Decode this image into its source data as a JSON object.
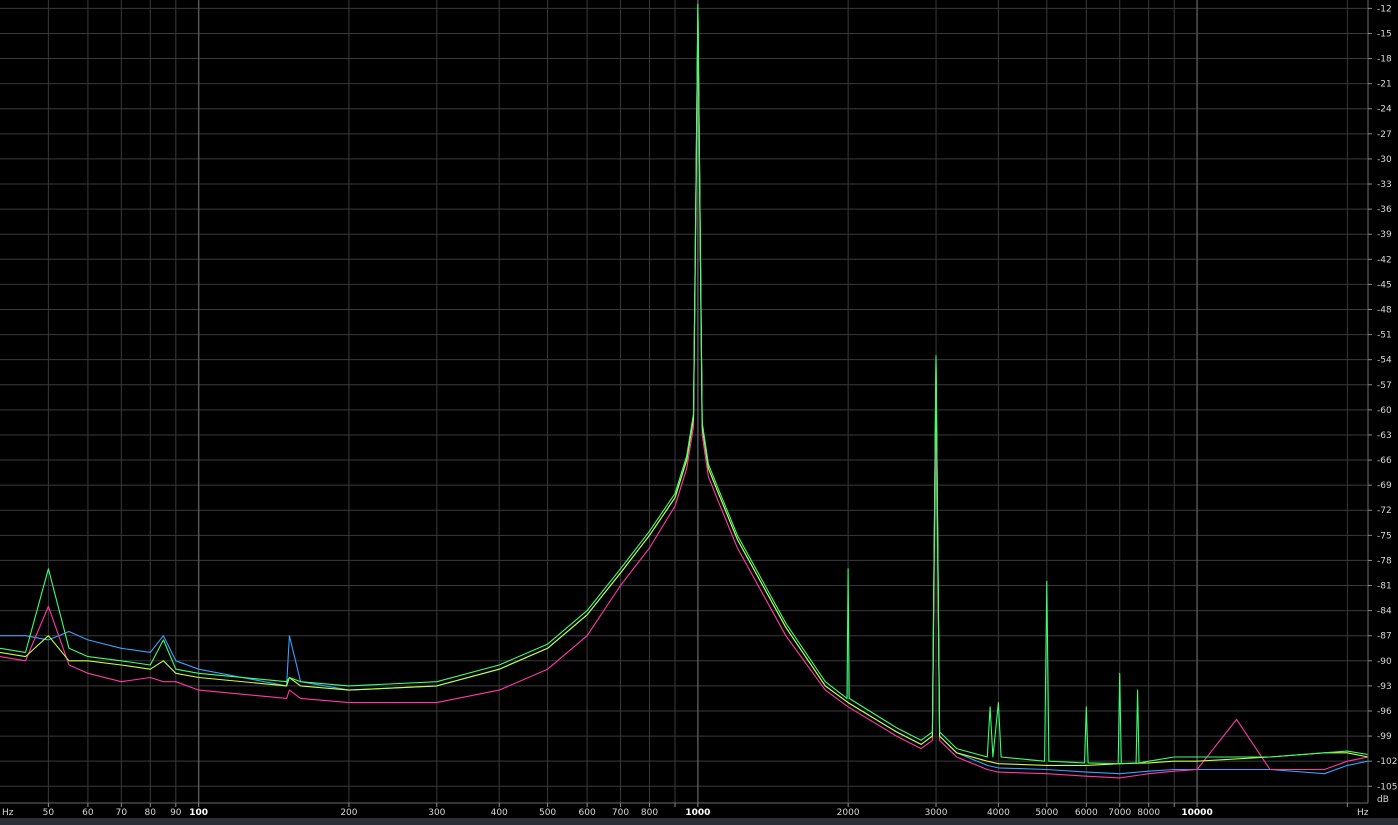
{
  "chart_data": {
    "type": "line",
    "title": "",
    "xlabel": "",
    "ylabel": "",
    "x_unit_label": "Hz",
    "x_unit_label_right": "Hz",
    "y_unit_label": "dB",
    "x_scale": "log",
    "xlim": [
      40,
      22000
    ],
    "ylim": [
      -107,
      -11
    ],
    "grid": true,
    "legend": "none",
    "background_color": "#000000",
    "grid_color": "#3a3a3a",
    "x_ticks": [
      {
        "value": 50,
        "label": "50",
        "major": false
      },
      {
        "value": 60,
        "label": "60",
        "major": false
      },
      {
        "value": 70,
        "label": "70",
        "major": false
      },
      {
        "value": 80,
        "label": "80",
        "major": false
      },
      {
        "value": 90,
        "label": "90",
        "major": false
      },
      {
        "value": 100,
        "label": "100",
        "major": true
      },
      {
        "value": 200,
        "label": "200",
        "major": false
      },
      {
        "value": 300,
        "label": "300",
        "major": false
      },
      {
        "value": 400,
        "label": "400",
        "major": false
      },
      {
        "value": 500,
        "label": "500",
        "major": false
      },
      {
        "value": 600,
        "label": "600",
        "major": false
      },
      {
        "value": 700,
        "label": "700",
        "major": false
      },
      {
        "value": 800,
        "label": "800",
        "major": false
      },
      {
        "value": 900,
        "label": "",
        "major": false
      },
      {
        "value": 1000,
        "label": "1000",
        "major": true
      },
      {
        "value": 2000,
        "label": "2000",
        "major": false
      },
      {
        "value": 3000,
        "label": "3000",
        "major": false
      },
      {
        "value": 4000,
        "label": "4000",
        "major": false
      },
      {
        "value": 5000,
        "label": "5000",
        "major": false
      },
      {
        "value": 6000,
        "label": "6000",
        "major": false
      },
      {
        "value": 7000,
        "label": "7000",
        "major": false
      },
      {
        "value": 8000,
        "label": "8000",
        "major": false
      },
      {
        "value": 9000,
        "label": "",
        "major": false
      },
      {
        "value": 10000,
        "label": "10000",
        "major": true
      },
      {
        "value": 20000,
        "label": "",
        "major": false
      }
    ],
    "y_ticks": [
      -12,
      -15,
      -18,
      -21,
      -24,
      -27,
      -30,
      -33,
      -36,
      -39,
      -42,
      -45,
      -48,
      -51,
      -54,
      -57,
      -60,
      -63,
      -66,
      -69,
      -72,
      -75,
      -78,
      -81,
      -84,
      -87,
      -90,
      -93,
      -96,
      -99,
      -102,
      -105
    ],
    "y_tick_labels": [
      "-12",
      "-15",
      "-18",
      "-21",
      "-24",
      "-27",
      "-30",
      "-33",
      "-36",
      "-39",
      "-42",
      "-45",
      "-48",
      "-51",
      "-54",
      "-57",
      "-60",
      "-63",
      "-66",
      "-69",
      "-72",
      "-75",
      "-78",
      "-81",
      "-84",
      "-87",
      "-90",
      "-93",
      "-96",
      "-99",
      "-102",
      "-105"
    ],
    "series": [
      {
        "color": "#3aa0ff",
        "x": [
          40,
          45,
          50,
          55,
          60,
          70,
          80,
          85,
          90,
          100,
          150,
          152,
          160,
          200,
          300,
          400,
          500,
          600,
          700,
          800,
          900,
          950,
          980,
          1000,
          1020,
          1050,
          1100,
          1200,
          1500,
          1800,
          2000,
          2500,
          2800,
          2950,
          3000,
          3050,
          3300,
          3800,
          4000,
          5000,
          6000,
          7000,
          8000,
          9000,
          10000,
          14000,
          18000,
          20000,
          22000
        ],
        "y": [
          -87,
          -87,
          -87.5,
          -86.5,
          -87.5,
          -88.5,
          -89,
          -87,
          -90,
          -91,
          -93,
          -87,
          -92.5,
          -93.5,
          -93,
          -91,
          -88.5,
          -84.5,
          -79.5,
          -75,
          -70.5,
          -66,
          -61,
          -12.5,
          -62,
          -67,
          -70,
          -75.5,
          -86,
          -93,
          -95,
          -98.5,
          -100,
          -99,
          -55,
          -99,
          -101,
          -102.5,
          -102.8,
          -103,
          -103.3,
          -103.5,
          -103.2,
          -103,
          -103,
          -103,
          -103.5,
          -102.5,
          -102
        ]
      },
      {
        "color": "#ff3aa6",
        "x": [
          40,
          45,
          50,
          55,
          60,
          70,
          80,
          85,
          90,
          100,
          150,
          152,
          160,
          200,
          300,
          400,
          500,
          600,
          700,
          800,
          900,
          950,
          980,
          1000,
          1020,
          1050,
          1100,
          1200,
          1500,
          1800,
          2000,
          2500,
          2800,
          2950,
          3000,
          3050,
          3300,
          3800,
          4000,
          5000,
          6000,
          7000,
          8000,
          9000,
          10000,
          12000,
          14000,
          18000,
          20000,
          22000
        ],
        "y": [
          -89.5,
          -90,
          -83.5,
          -90.5,
          -91.5,
          -92.5,
          -92,
          -92.5,
          -92.5,
          -93.5,
          -94.5,
          -93.5,
          -94.5,
          -95,
          -95,
          -93.5,
          -91,
          -87,
          -81,
          -76.5,
          -71.5,
          -67,
          -62,
          -15,
          -63,
          -68,
          -71,
          -76.5,
          -87,
          -93.5,
          -95.5,
          -99,
          -100.5,
          -99.5,
          -60,
          -99.5,
          -101.5,
          -103,
          -103.3,
          -103.5,
          -103.8,
          -104,
          -103.5,
          -103.2,
          -103,
          -97,
          -103,
          -103,
          -102,
          -101.5
        ]
      },
      {
        "color": "#c8ff3a",
        "x": [
          40,
          45,
          50,
          55,
          60,
          70,
          80,
          85,
          90,
          100,
          150,
          152,
          160,
          200,
          300,
          400,
          500,
          600,
          700,
          800,
          900,
          950,
          980,
          1000,
          1020,
          1050,
          1100,
          1200,
          1500,
          1800,
          2000,
          2500,
          2800,
          2950,
          3000,
          3050,
          3300,
          3800,
          4000,
          5000,
          6000,
          7000,
          8000,
          9000,
          10000,
          14000,
          18000,
          20000,
          22000
        ],
        "y": [
          -89,
          -89.5,
          -87,
          -90,
          -90,
          -90.5,
          -91,
          -90,
          -91.5,
          -92,
          -93,
          -92,
          -93,
          -93.5,
          -93,
          -91,
          -88.5,
          -84.5,
          -79.5,
          -75,
          -70.5,
          -66,
          -61,
          -12,
          -62,
          -67,
          -70,
          -75.5,
          -86,
          -93,
          -95,
          -98.5,
          -100,
          -99,
          -54,
          -99,
          -101,
          -102,
          -102.3,
          -102.5,
          -102.5,
          -102.3,
          -102.2,
          -102,
          -102,
          -101.5,
          -101,
          -101,
          -101.5
        ]
      },
      {
        "color": "#3aff70",
        "x": [
          40,
          45,
          50,
          55,
          60,
          70,
          80,
          85,
          90,
          100,
          150,
          152,
          160,
          200,
          300,
          400,
          500,
          600,
          700,
          800,
          900,
          950,
          980,
          1000,
          1020,
          1050,
          1100,
          1200,
          1500,
          1800,
          1990,
          2000,
          2010,
          2500,
          2800,
          2950,
          3000,
          3050,
          3300,
          3800,
          3850,
          3900,
          4000,
          4050,
          4950,
          5000,
          5050,
          5950,
          6000,
          6050,
          6950,
          7000,
          7050,
          7550,
          7600,
          7650,
          8000,
          9000,
          10000,
          14000,
          18000,
          20000,
          22000
        ],
        "y": [
          -88.5,
          -89,
          -79,
          -88.5,
          -89.5,
          -90,
          -90.5,
          -87.5,
          -91,
          -91.5,
          -92.5,
          -92,
          -92.5,
          -93,
          -92.5,
          -90.5,
          -88,
          -84,
          -79,
          -74.5,
          -70,
          -65.5,
          -60.5,
          -11.5,
          -61.5,
          -66.5,
          -69.5,
          -75,
          -85.5,
          -92.5,
          -94.5,
          -79,
          -94.5,
          -98,
          -99.5,
          -98.5,
          -53.5,
          -98.5,
          -100.5,
          -101.5,
          -95.5,
          -101.5,
          -95,
          -101.5,
          -102,
          -80.5,
          -102,
          -102.2,
          -95.5,
          -102.2,
          -102.3,
          -91.5,
          -102.3,
          -102.2,
          -93.5,
          -102.2,
          -102,
          -101.5,
          -101.5,
          -101.5,
          -101,
          -100.8,
          -101.2
        ]
      }
    ]
  }
}
